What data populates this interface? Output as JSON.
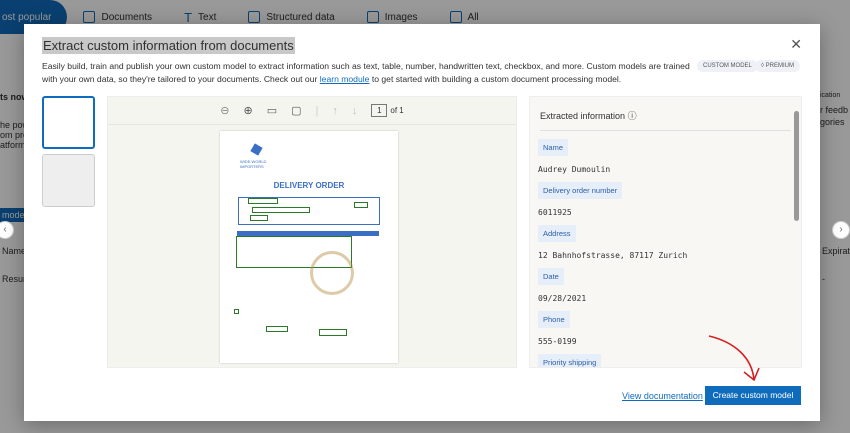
{
  "tabs": [
    {
      "label": "ost popular",
      "icon": "star-icon"
    },
    {
      "label": "Documents",
      "icon": "document-icon"
    },
    {
      "label": "Text",
      "icon": "text-icon"
    },
    {
      "label": "Structured data",
      "icon": "database-icon"
    },
    {
      "label": "Images",
      "icon": "image-icon"
    },
    {
      "label": "All",
      "icon": "grid-icon"
    }
  ],
  "background": {
    "left": [
      "ts now",
      "he pow",
      "om pro",
      "atform."
    ],
    "model_tab": "model",
    "name_col": "Name",
    "row": "Resum",
    "right": [
      "ication",
      "r feedb",
      "gories"
    ],
    "exp_col": "Expirati",
    "dash": "-"
  },
  "modal": {
    "title": "Extract custom information from documents",
    "desc_before": "Easily build, train and publish your own custom model to extract information such as text, table, number, handwritten text, checkbox, and more. Custom models are trained with your own data, so they're tailored to your documents. Check out our ",
    "desc_link": "learn module",
    "desc_after": " to get started with building a custom document processing model.",
    "badges": [
      "CUSTOM MODEL",
      "PREMIUM"
    ],
    "viewer": {
      "page": "1",
      "page_total": "of 1",
      "doc_heading": "DELIVERY ORDER",
      "doc_company": "WIDE WORLD IMPORTERS"
    },
    "extracted": {
      "title": "Extracted information",
      "fields": [
        {
          "label": "Name",
          "value": "Audrey Dumoulin"
        },
        {
          "label": "Delivery order number",
          "value": "6011925"
        },
        {
          "label": "Address",
          "value": "12 Bahnhofstrasse, 87117 Zurich"
        },
        {
          "label": "Date",
          "value": "09/28/2021"
        },
        {
          "label": "Phone",
          "value": "555-0199"
        },
        {
          "label": "Priority shipping",
          "value": ""
        }
      ]
    },
    "view_doc": "View documentation",
    "create": "Create custom model"
  }
}
